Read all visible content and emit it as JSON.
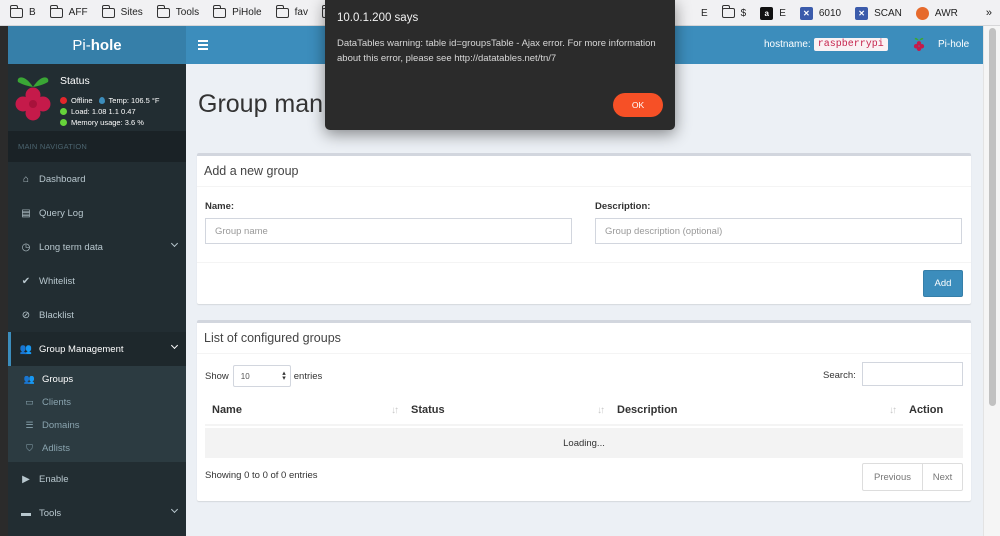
{
  "bookmarks": {
    "left": [
      {
        "label": "B",
        "icon": "folder-icon"
      },
      {
        "label": "AFF",
        "icon": "folder-icon"
      },
      {
        "label": "Sites",
        "icon": "folder-icon"
      },
      {
        "label": "Tools",
        "icon": "folder-icon"
      },
      {
        "label": "PiHole",
        "icon": "folder-icon"
      },
      {
        "label": "fav",
        "icon": "folder-icon"
      }
    ],
    "right": [
      {
        "label": "E",
        "icon": "folder-icon"
      },
      {
        "label": "$",
        "icon": "folder-icon"
      },
      {
        "label": "E",
        "icon": "amazon-icon"
      },
      {
        "label": "6010",
        "icon": "scan-icon"
      },
      {
        "label": "SCAN",
        "icon": "scan-icon"
      },
      {
        "label": "AWR",
        "icon": "firefox-icon"
      }
    ],
    "more": "»"
  },
  "header": {
    "logo_pre": "Pi-",
    "logo_bold": "hole",
    "hostname_label": "hostname:",
    "hostname_value": "raspberrypi",
    "user_label": "Pi-hole"
  },
  "sidebar": {
    "status_title": "Status",
    "status": {
      "offline": "Offline",
      "temp": "Temp: 106.5 °F",
      "load": "Load:  1.08  1.1  0.47",
      "memory": "Memory usage:  3.6 %"
    },
    "nav_header": "MAIN NAVIGATION",
    "items": [
      {
        "label": "Dashboard"
      },
      {
        "label": "Query Log"
      },
      {
        "label": "Long term data"
      },
      {
        "label": "Whitelist"
      },
      {
        "label": "Blacklist"
      },
      {
        "label": "Group Management"
      },
      {
        "label": "Enable"
      },
      {
        "label": "Tools"
      }
    ],
    "subitems": [
      {
        "label": "Groups"
      },
      {
        "label": "Clients"
      },
      {
        "label": "Domains"
      },
      {
        "label": "Adlists"
      }
    ]
  },
  "content": {
    "page_title": "Group man",
    "add_box": {
      "title": "Add a new group",
      "name_label": "Name:",
      "name_placeholder": "Group name",
      "name_value": "",
      "desc_label": "Description:",
      "desc_placeholder": "Group description (optional)",
      "desc_value": "",
      "add_button": "Add"
    },
    "list_box": {
      "title": "List of configured groups",
      "show_label": "Show",
      "entries_value": "10",
      "entries_label": "entries",
      "search_label": "Search:",
      "search_value": "",
      "columns": [
        "Name",
        "Status",
        "Description",
        "Action"
      ],
      "loading": "Loading...",
      "info": "Showing 0 to 0 of 0 entries",
      "prev": "Previous",
      "next": "Next"
    }
  },
  "dialog": {
    "title": "10.0.1.200 says",
    "message": "DataTables warning: table id=groupsTable - Ajax error. For more information about this error, please see http://datatables.net/tn/7",
    "ok": "OK"
  },
  "colors": {
    "header_blue": "#3c8dbc",
    "sidebar_dark": "#222d32",
    "ok_orange": "#f65026"
  }
}
